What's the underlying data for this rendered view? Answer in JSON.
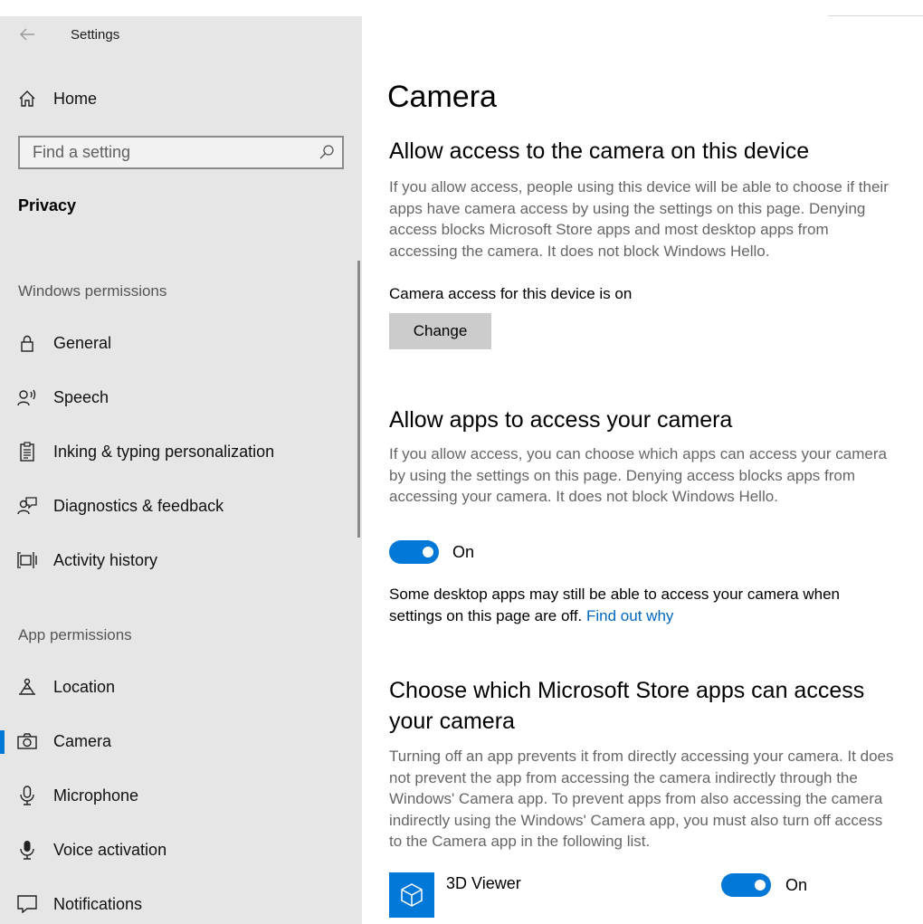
{
  "window": {
    "title": "Settings"
  },
  "sidebar": {
    "home_label": "Home",
    "search_placeholder": "Find a setting",
    "section_title": "Privacy",
    "groups": {
      "windows_permissions": "Windows permissions",
      "app_permissions": "App permissions"
    },
    "windows_items": [
      {
        "label": "General",
        "icon": "lock-icon"
      },
      {
        "label": "Speech",
        "icon": "speech-icon"
      },
      {
        "label": "Inking & typing personalization",
        "icon": "clipboard-icon"
      },
      {
        "label": "Diagnostics & feedback",
        "icon": "feedback-icon"
      },
      {
        "label": "Activity history",
        "icon": "activity-icon"
      }
    ],
    "app_items": [
      {
        "label": "Location",
        "icon": "location-icon"
      },
      {
        "label": "Camera",
        "icon": "camera-icon",
        "selected": true
      },
      {
        "label": "Microphone",
        "icon": "microphone-icon"
      },
      {
        "label": "Voice activation",
        "icon": "voice-icon"
      },
      {
        "label": "Notifications",
        "icon": "notifications-icon"
      }
    ]
  },
  "main": {
    "title": "Camera",
    "device_access": {
      "heading": "Allow access to the camera on this device",
      "description": "If you allow access, people using this device will be able to choose if their apps have camera access by using the settings on this page. Denying access blocks Microsoft Store apps and most desktop apps from accessing the camera. It does not block Windows Hello.",
      "status": "Camera access for this device is on",
      "button_label": "Change"
    },
    "apps_access": {
      "heading": "Allow apps to access your camera",
      "description": "If you allow access, you can choose which apps can access your camera by using the settings on this page. Denying access blocks apps from accessing your camera. It does not block Windows Hello.",
      "toggle_label": "On",
      "toggle_on": true,
      "note": "Some desktop apps may still be able to access your camera when settings on this page are off.",
      "note_link": "Find out why"
    },
    "store_apps": {
      "heading": "Choose which Microsoft Store apps can access your camera",
      "description": "Turning off an app prevents it from directly accessing your camera. It does not prevent the app from accessing the camera indirectly through the Windows' Camera app. To prevent apps from also accessing the camera indirectly using the Windows' Camera app, you must also turn off access to the Camera app in the following list.",
      "apps": [
        {
          "name": "3D Viewer",
          "toggle_label": "On",
          "toggle_on": true,
          "icon": "3d-viewer-icon"
        }
      ]
    }
  },
  "colors": {
    "accent": "#0078d7",
    "sidebar_bg": "#e6e6e6",
    "link": "#0067c0"
  }
}
